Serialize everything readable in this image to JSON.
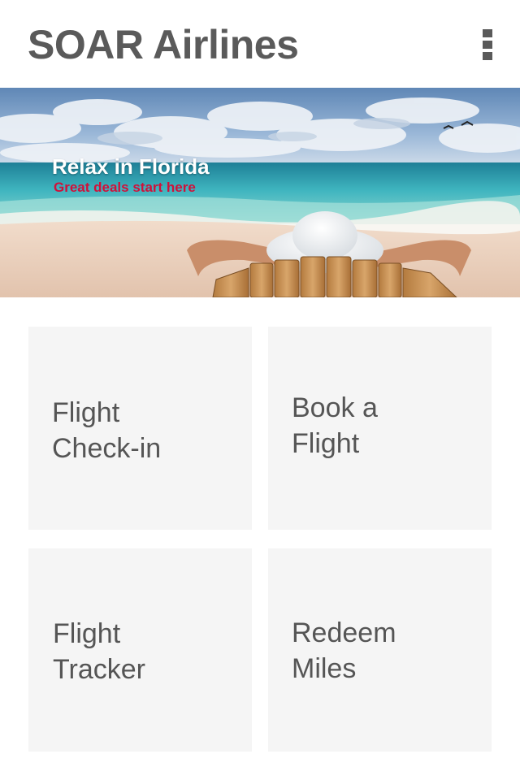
{
  "header": {
    "title": "SOAR Airlines",
    "menu_icon": "more-vertical-icon"
  },
  "banner": {
    "title": "Relax in Florida",
    "subtitle": "Great deals start here",
    "colors": {
      "title": "#ffffff",
      "subtitle": "#d0103a"
    }
  },
  "tiles": [
    {
      "label": "Flight\nCheck-in"
    },
    {
      "label": "Book a\nFlight"
    },
    {
      "label": "Flight\nTracker"
    },
    {
      "label": "Redeem\nMiles"
    }
  ],
  "colors": {
    "title_text": "#5a5a5a",
    "tile_bg": "#f5f5f5",
    "tile_text": "#555555"
  }
}
